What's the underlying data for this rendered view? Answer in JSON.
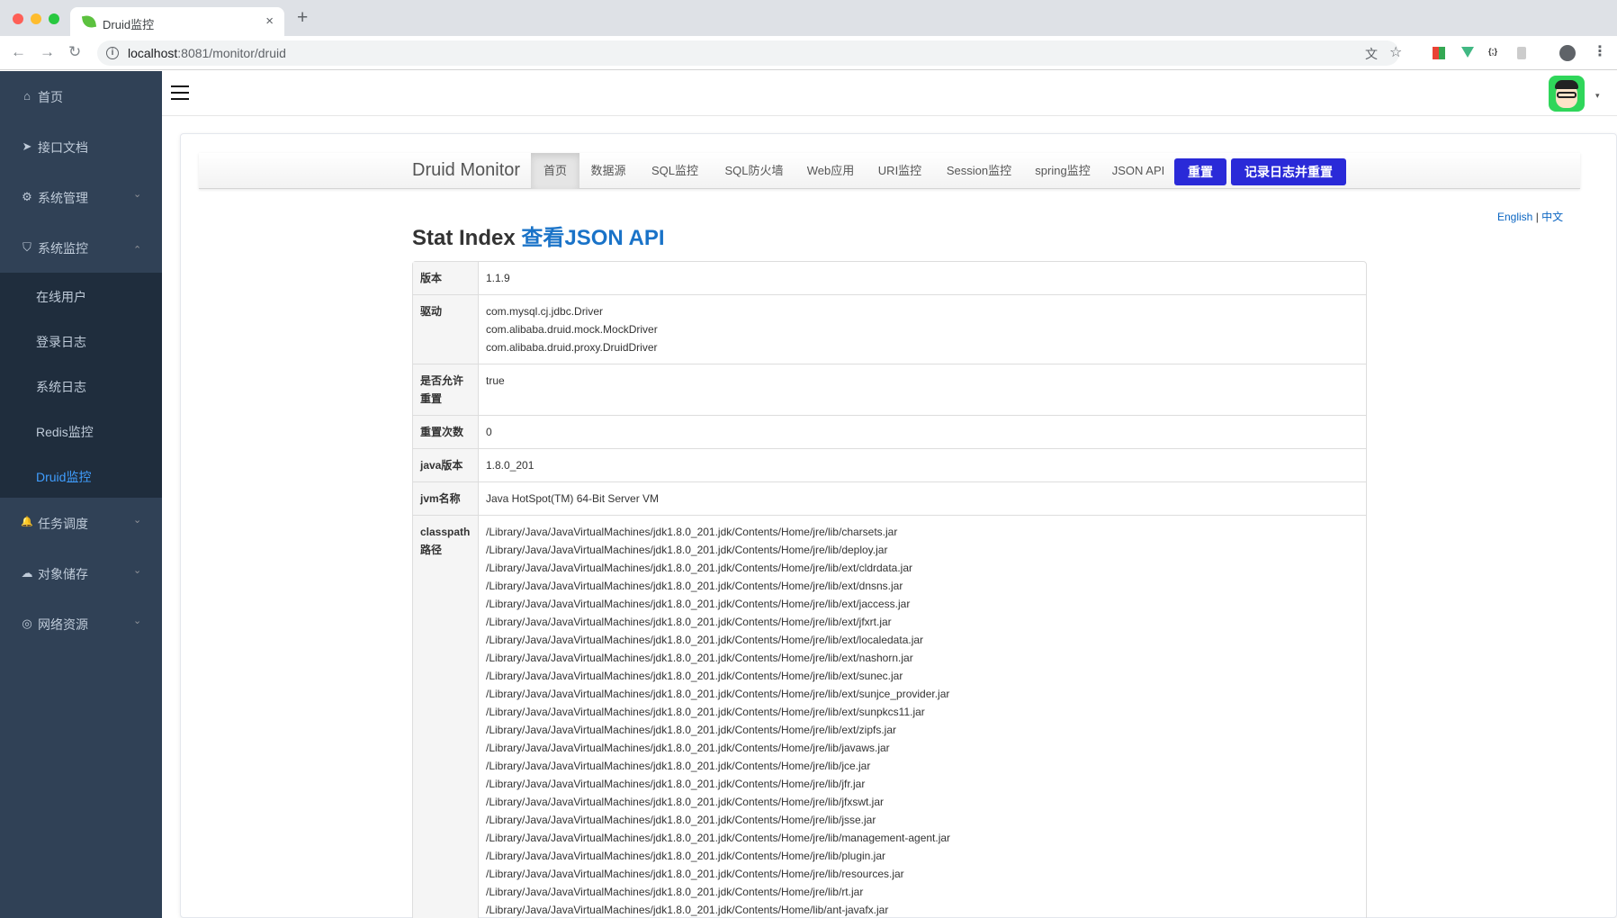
{
  "browser": {
    "tab_title": "Druid监控",
    "tab_close": "×",
    "new_tab": "+",
    "url_host": "localhost",
    "url_rest": ":8081/monitor/druid",
    "back": "←",
    "forward": "→",
    "reload": "↻",
    "translate_icon": "文",
    "star_icon": "☆",
    "menu_dots": "⋮"
  },
  "sidebar": {
    "items": [
      {
        "label": "首页",
        "icon": "home-icon",
        "glyph": "⌂"
      },
      {
        "label": "接口文档",
        "icon": "send-icon",
        "glyph": "➤"
      },
      {
        "label": "系统管理",
        "icon": "gear-icon",
        "glyph": "⚙",
        "chevron": "⌄"
      },
      {
        "label": "系统监控",
        "icon": "shield-icon",
        "glyph": "⛉",
        "chevron": "⌃"
      }
    ],
    "submenu": [
      {
        "label": "在线用户"
      },
      {
        "label": "登录日志"
      },
      {
        "label": "系统日志"
      },
      {
        "label": "Redis监控"
      },
      {
        "label": "Druid监控",
        "active": true
      }
    ],
    "bottom_items": [
      {
        "label": "任务调度",
        "icon": "bell-icon",
        "glyph": "🔔",
        "chevron": "⌄"
      },
      {
        "label": "对象储存",
        "icon": "cloud-icon",
        "glyph": "☁",
        "chevron": "⌄"
      },
      {
        "label": "网络资源",
        "icon": "globe-icon",
        "glyph": "◎",
        "chevron": "⌄"
      }
    ]
  },
  "header": {
    "avatar_caret": "▾"
  },
  "druid": {
    "brand": "Druid Monitor",
    "nav": [
      "首页",
      "数据源",
      "SQL监控",
      "SQL防火墙",
      "Web应用",
      "URI监控",
      "Session监控",
      "spring监控",
      "JSON API"
    ],
    "active_nav": "首页",
    "reset_button": "重置",
    "log_reset_button": "记录日志并重置",
    "lang_en": "English",
    "lang_sep": " | ",
    "lang_zh": "中文",
    "title": "Stat Index ",
    "title_link": "查看JSON API"
  },
  "stat": {
    "version_key": "版本",
    "version": "1.1.9",
    "driver_key": "驱动",
    "drivers": [
      "com.mysql.cj.jdbc.Driver",
      "com.alibaba.druid.mock.MockDriver",
      "com.alibaba.druid.proxy.DruidDriver"
    ],
    "reset_enable_key": "是否允许重置",
    "reset_enable": "true",
    "reset_count_key": "重置次数",
    "reset_count": "0",
    "java_version_key": "java版本",
    "java_version": "1.8.0_201",
    "jvm_name_key": "jvm名称",
    "jvm_name": "Java HotSpot(TM) 64-Bit Server VM",
    "classpath_key": "classpath路径",
    "classpath": [
      "/Library/Java/JavaVirtualMachines/jdk1.8.0_201.jdk/Contents/Home/jre/lib/charsets.jar",
      "/Library/Java/JavaVirtualMachines/jdk1.8.0_201.jdk/Contents/Home/jre/lib/deploy.jar",
      "/Library/Java/JavaVirtualMachines/jdk1.8.0_201.jdk/Contents/Home/jre/lib/ext/cldrdata.jar",
      "/Library/Java/JavaVirtualMachines/jdk1.8.0_201.jdk/Contents/Home/jre/lib/ext/dnsns.jar",
      "/Library/Java/JavaVirtualMachines/jdk1.8.0_201.jdk/Contents/Home/jre/lib/ext/jaccess.jar",
      "/Library/Java/JavaVirtualMachines/jdk1.8.0_201.jdk/Contents/Home/jre/lib/ext/jfxrt.jar",
      "/Library/Java/JavaVirtualMachines/jdk1.8.0_201.jdk/Contents/Home/jre/lib/ext/localedata.jar",
      "/Library/Java/JavaVirtualMachines/jdk1.8.0_201.jdk/Contents/Home/jre/lib/ext/nashorn.jar",
      "/Library/Java/JavaVirtualMachines/jdk1.8.0_201.jdk/Contents/Home/jre/lib/ext/sunec.jar",
      "/Library/Java/JavaVirtualMachines/jdk1.8.0_201.jdk/Contents/Home/jre/lib/ext/sunjce_provider.jar",
      "/Library/Java/JavaVirtualMachines/jdk1.8.0_201.jdk/Contents/Home/jre/lib/ext/sunpkcs11.jar",
      "/Library/Java/JavaVirtualMachines/jdk1.8.0_201.jdk/Contents/Home/jre/lib/ext/zipfs.jar",
      "/Library/Java/JavaVirtualMachines/jdk1.8.0_201.jdk/Contents/Home/jre/lib/javaws.jar",
      "/Library/Java/JavaVirtualMachines/jdk1.8.0_201.jdk/Contents/Home/jre/lib/jce.jar",
      "/Library/Java/JavaVirtualMachines/jdk1.8.0_201.jdk/Contents/Home/jre/lib/jfr.jar",
      "/Library/Java/JavaVirtualMachines/jdk1.8.0_201.jdk/Contents/Home/jre/lib/jfxswt.jar",
      "/Library/Java/JavaVirtualMachines/jdk1.8.0_201.jdk/Contents/Home/jre/lib/jsse.jar",
      "/Library/Java/JavaVirtualMachines/jdk1.8.0_201.jdk/Contents/Home/jre/lib/management-agent.jar",
      "/Library/Java/JavaVirtualMachines/jdk1.8.0_201.jdk/Contents/Home/jre/lib/plugin.jar",
      "/Library/Java/JavaVirtualMachines/jdk1.8.0_201.jdk/Contents/Home/jre/lib/resources.jar",
      "/Library/Java/JavaVirtualMachines/jdk1.8.0_201.jdk/Contents/Home/jre/lib/rt.jar",
      "/Library/Java/JavaVirtualMachines/jdk1.8.0_201.jdk/Contents/Home/lib/ant-javafx.jar"
    ]
  },
  "colors": {
    "sidebar_bg": "#304156",
    "submenu_bg": "#1f2d3d",
    "sidebar_text": "#bfcbd9",
    "active_text": "#409eff",
    "button_blue": "#2a2ad8",
    "link_blue": "#1a73c8"
  }
}
